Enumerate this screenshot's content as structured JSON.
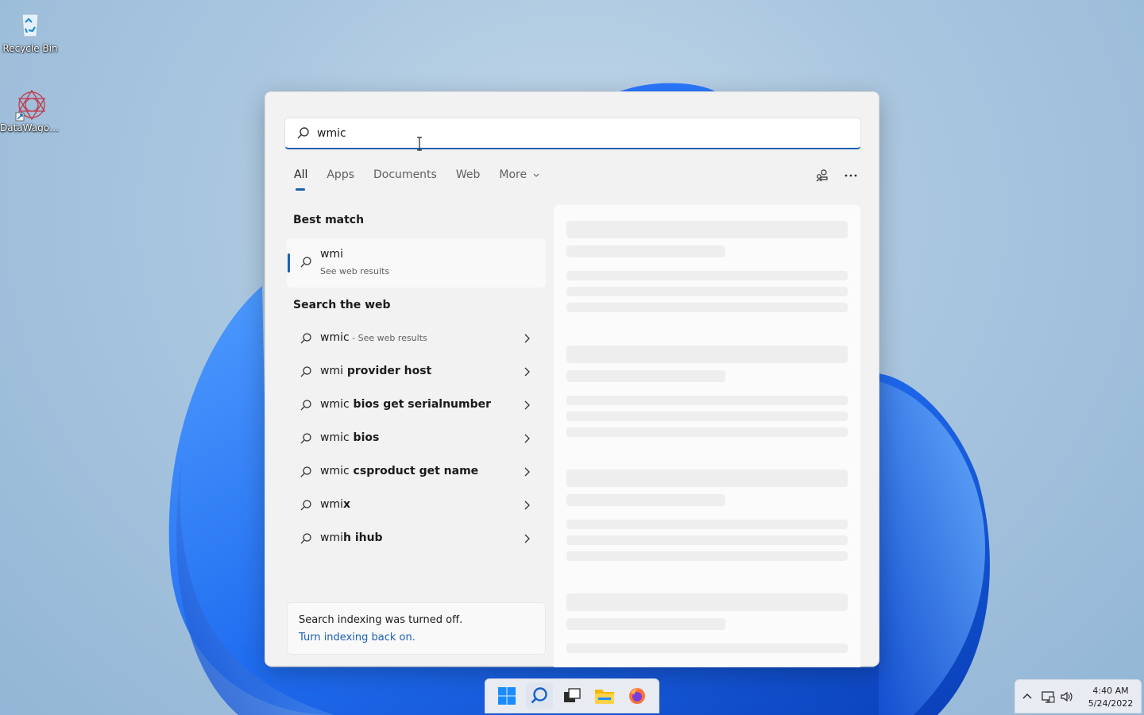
{
  "desktop": {
    "icons": [
      {
        "label": "Recycle Bin"
      },
      {
        "label": "DataWagon..."
      }
    ]
  },
  "search": {
    "query": "wmic",
    "tabs": [
      "All",
      "Apps",
      "Documents",
      "Web",
      "More"
    ],
    "active_tab": "All",
    "best_match": {
      "heading": "Best match",
      "title": "wmi",
      "subtitle": "See web results"
    },
    "web": {
      "heading": "Search the web",
      "items": [
        {
          "prefix": "wmic",
          "bold": "",
          "suffix": " - See web results"
        },
        {
          "prefix": "wmi",
          "bold": " provider host",
          "suffix": ""
        },
        {
          "prefix": "wmic",
          "bold": " bios get serialnumber",
          "suffix": ""
        },
        {
          "prefix": "wmic",
          "bold": " bios",
          "suffix": ""
        },
        {
          "prefix": "wmic",
          "bold": " csproduct get name",
          "suffix": ""
        },
        {
          "prefix": "wmi",
          "bold": "x",
          "suffix": ""
        },
        {
          "prefix": "wmi",
          "bold": "h ihub",
          "suffix": ""
        }
      ]
    },
    "indexing": {
      "message": "Search indexing was turned off.",
      "link": "Turn indexing back on."
    }
  },
  "taskbar": {
    "items": [
      "start",
      "search",
      "task-view",
      "file-explorer",
      "firefox"
    ]
  },
  "tray": {
    "time": "4:40 AM",
    "date": "5/24/2022"
  },
  "colors": {
    "accent": "#1a5fb4"
  }
}
